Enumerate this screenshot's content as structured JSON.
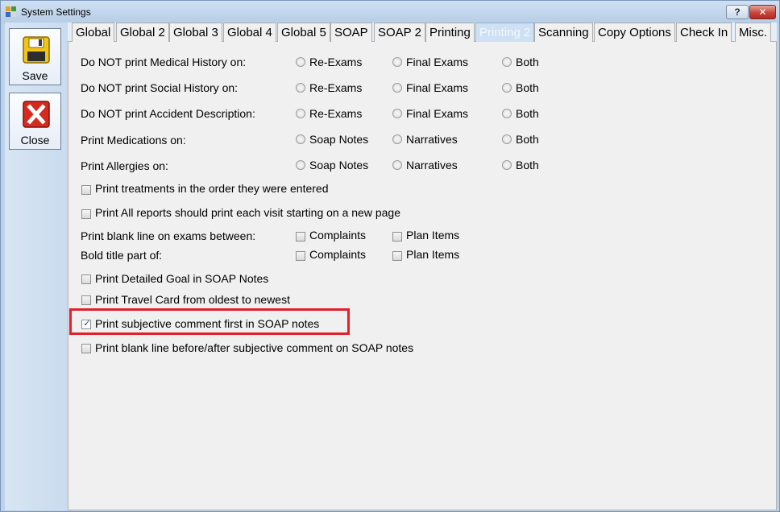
{
  "window": {
    "title": "System Settings",
    "help_label": "?",
    "close_label": "✕"
  },
  "toolbar": {
    "save_label": "Save",
    "close_label": "Close"
  },
  "tabs": [
    {
      "label": "Global"
    },
    {
      "label": "Global 2"
    },
    {
      "label": "Global 3"
    },
    {
      "label": "Global 4"
    },
    {
      "label": "Global 5"
    },
    {
      "label": "SOAP"
    },
    {
      "label": "SOAP 2"
    },
    {
      "label": "Printing"
    },
    {
      "label": "Printing 2"
    },
    {
      "label": "Scanning"
    },
    {
      "label": "Copy Options"
    },
    {
      "label": "Check In"
    },
    {
      "label": "Misc."
    }
  ],
  "active_tab": "Printing 2",
  "settings": {
    "medical_history": {
      "label": "Do NOT print Medical History on:",
      "opt1": "Re-Exams",
      "opt2": "Final Exams",
      "opt3": "Both"
    },
    "social_history": {
      "label": "Do NOT print Social History on:",
      "opt1": "Re-Exams",
      "opt2": "Final Exams",
      "opt3": "Both"
    },
    "accident_description": {
      "label": "Do NOT print Accident Description:",
      "opt1": "Re-Exams",
      "opt2": "Final Exams",
      "opt3": "Both"
    },
    "medications": {
      "label": "Print Medications on:",
      "opt1": "Soap Notes",
      "opt2": "Narratives",
      "opt3": "Both"
    },
    "allergies": {
      "label": "Print Allergies on:",
      "opt1": "Soap Notes",
      "opt2": "Narratives",
      "opt3": "Both"
    },
    "treatments_order": {
      "label": "Print treatments in the order they were entered",
      "checked": false
    },
    "reports_new_page": {
      "label": "Print All reports should print each visit starting on a new page",
      "checked": false
    },
    "blank_line_exams": {
      "label": "Print blank line on exams between:",
      "opt1": "Complaints",
      "opt2": "Plan Items"
    },
    "bold_title": {
      "label": "Bold title part of:",
      "opt1": "Complaints",
      "opt2": "Plan Items"
    },
    "detailed_goal": {
      "label": "Print Detailed Goal in SOAP Notes",
      "checked": false
    },
    "travel_card": {
      "label": "Print Travel Card from oldest to newest",
      "checked": false
    },
    "subjective_first": {
      "label": "Print subjective comment first in SOAP notes",
      "checked": true
    },
    "blank_line_subjective": {
      "label": "Print blank line before/after subjective comment on SOAP notes",
      "checked": false
    }
  },
  "colors": {
    "highlight": "#e2202b",
    "active_tab_bg": "#cde0f4"
  }
}
